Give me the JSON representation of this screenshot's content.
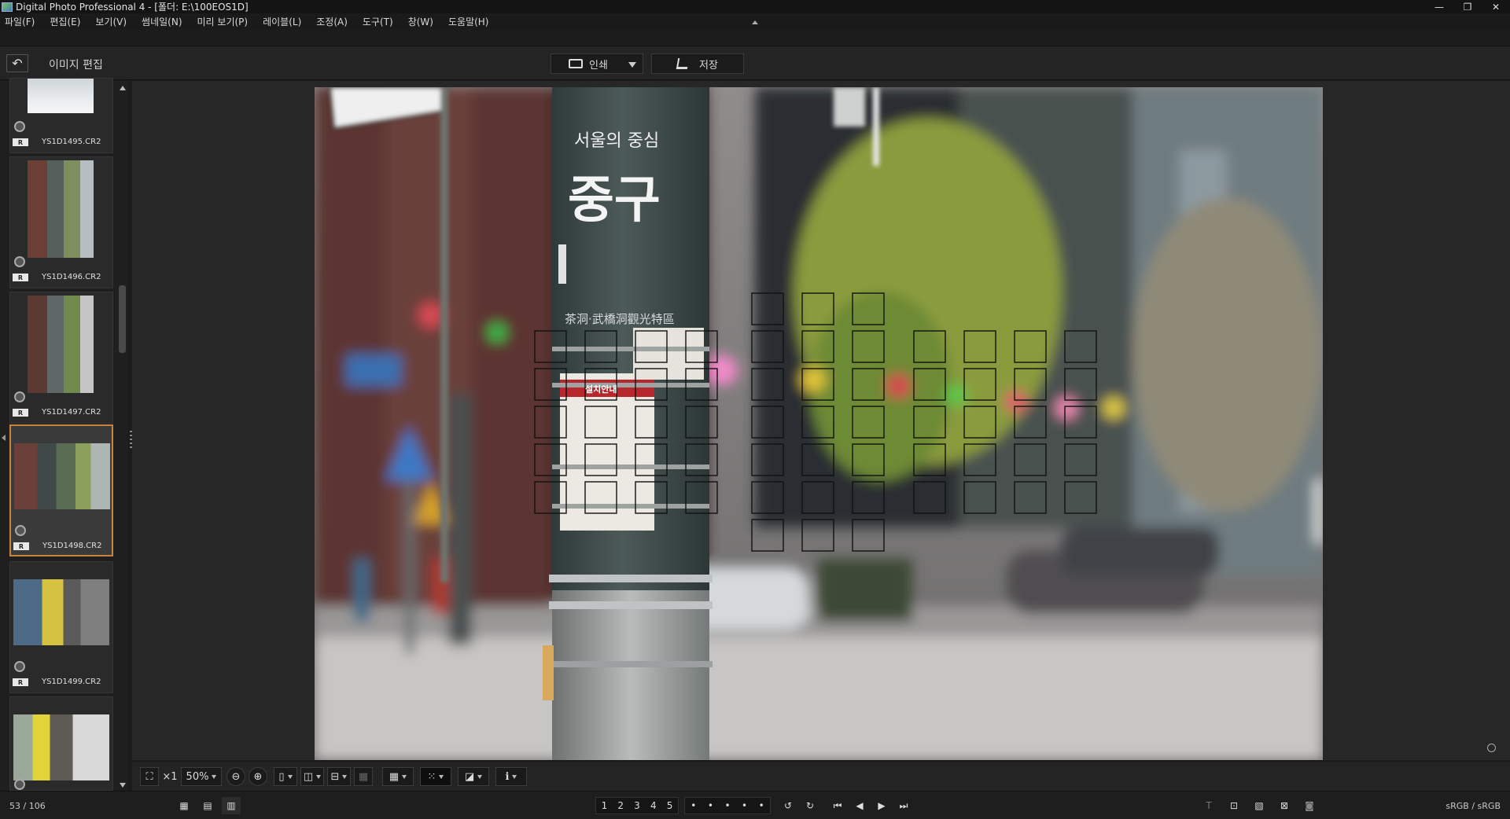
{
  "window": {
    "title": "Digital Photo Professional 4 - [폴더: E:\\100EOS1D]",
    "controls": [
      "minimize-icon",
      "restore-icon",
      "close-icon"
    ]
  },
  "menu": [
    "파일(F)",
    "편집(E)",
    "보기(V)",
    "썸네일(N)",
    "미리 보기(P)",
    "레이블(L)",
    "조정(A)",
    "도구(T)",
    "창(W)",
    "도움말(H)"
  ],
  "toolbar": {
    "mode_title": "이미지 편집",
    "print_label": "인쇄",
    "save_label": "저장"
  },
  "thumbnails": [
    {
      "file": "YS1D1495.CR2",
      "badge": "R",
      "selected": false
    },
    {
      "file": "YS1D1496.CR2",
      "badge": "R",
      "selected": false
    },
    {
      "file": "YS1D1497.CR2",
      "badge": "R",
      "selected": false
    },
    {
      "file": "YS1D1498.CR2",
      "badge": "R",
      "selected": true
    },
    {
      "file": "YS1D1499.CR2",
      "badge": "R",
      "selected": false
    },
    {
      "file": "",
      "badge": "",
      "selected": false
    }
  ],
  "viewer": {
    "sign_text": "서울의 중심",
    "sign_big": "중구",
    "sign_sub": "茶洞·武橋洞觀光特區",
    "notice_title": "설치안내",
    "zoom_x1": "×1",
    "zoom_level": "50%"
  },
  "statusbar": {
    "count": "53 / 106",
    "colorspace": "sRGB / sRGB",
    "ratings": [
      "1",
      "2",
      "3",
      "4",
      "5"
    ]
  },
  "colors": {
    "accent": "#c8843a",
    "background": "#1c1c1c",
    "panel": "#242424"
  }
}
